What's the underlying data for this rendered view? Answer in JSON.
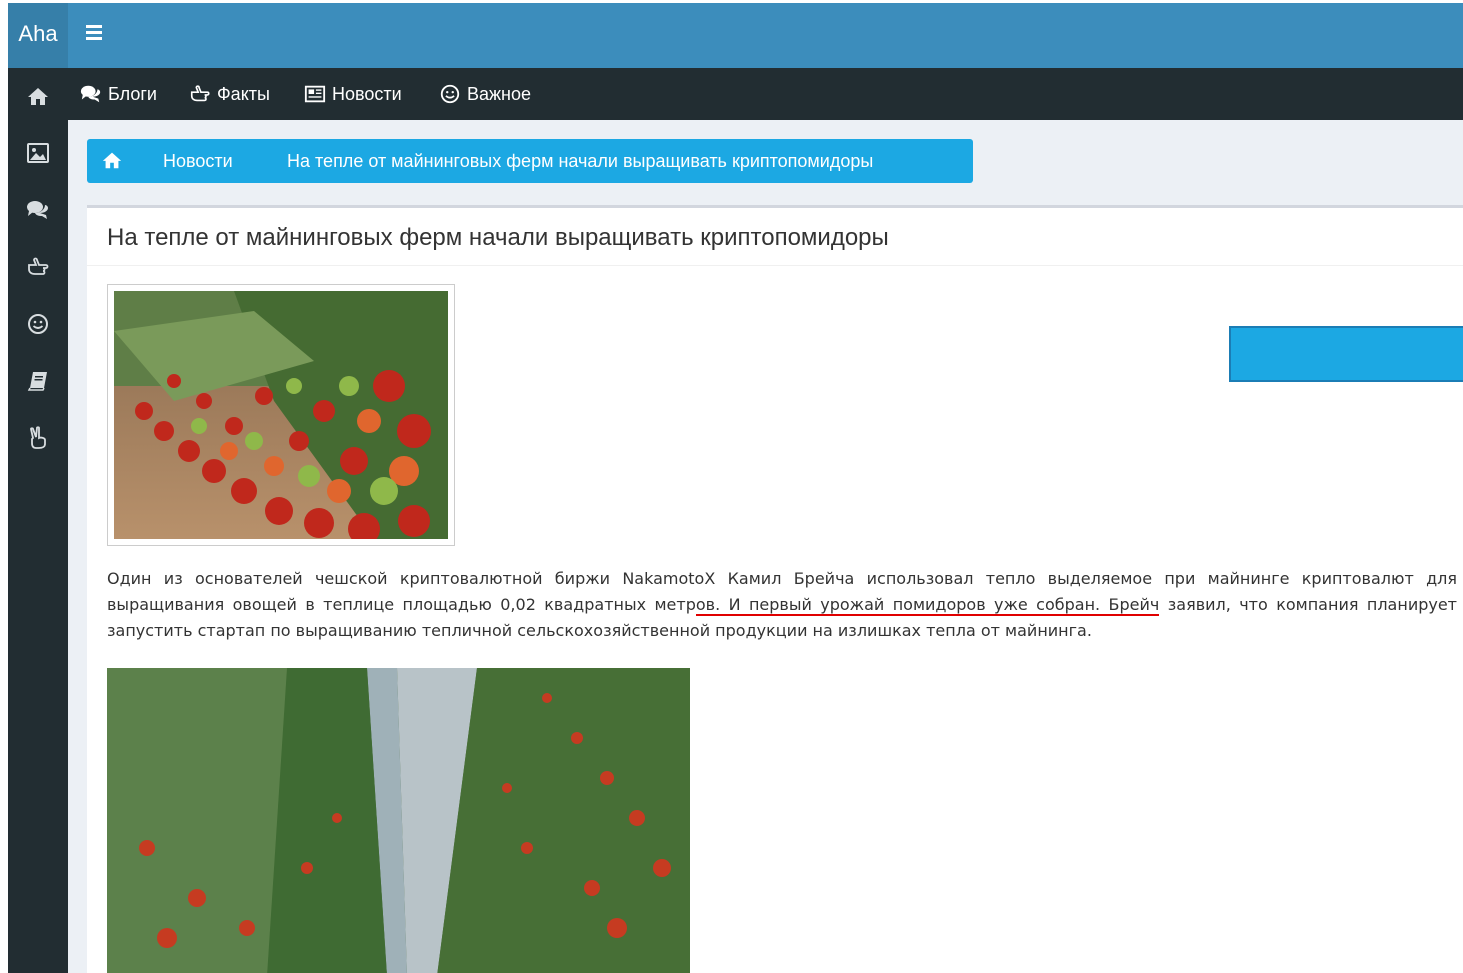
{
  "brand": {
    "logo_text": "Aha"
  },
  "topnav": {
    "items": [
      {
        "label": "Блоги",
        "icon": "comments-icon"
      },
      {
        "label": "Факты",
        "icon": "hand-point-icon"
      },
      {
        "label": "Новости",
        "icon": "newspaper-icon"
      },
      {
        "label": "Важное",
        "icon": "smile-icon"
      }
    ]
  },
  "sidebar": {
    "icons": [
      "home-icon",
      "image-icon",
      "comments-icon",
      "hand-point-icon",
      "smile-icon",
      "book-icon",
      "peace-hand-icon"
    ]
  },
  "breadcrumb": {
    "section": "Новости",
    "current": "На тепле от майнинговых ферм начали выращивать криптопомидоры"
  },
  "article": {
    "title": "На тепле от майнинговых ферм начали выращивать криптопомидоры",
    "paragraph_part1": "Один из основателей чешской криптовалютной биржи NakamotoX Камил Брейча использовал тепло выделяемое при майнинге криптовалют для выращивания овощей в теплице площадью 0,02 квадратных метр",
    "paragraph_underlined": "ов. И первый урожай помидоров уже собран. Брейч",
    "paragraph_part2": " заявил, что компания планирует запустить стартап по выращиванию тепличной сельскохозяйственной продукции на излишках тепла от майнинга."
  },
  "colors": {
    "header": "#3c8dbc",
    "sidebar": "#222d32",
    "breadcrumb": "#1ca8e3",
    "underline": "#e00000"
  }
}
